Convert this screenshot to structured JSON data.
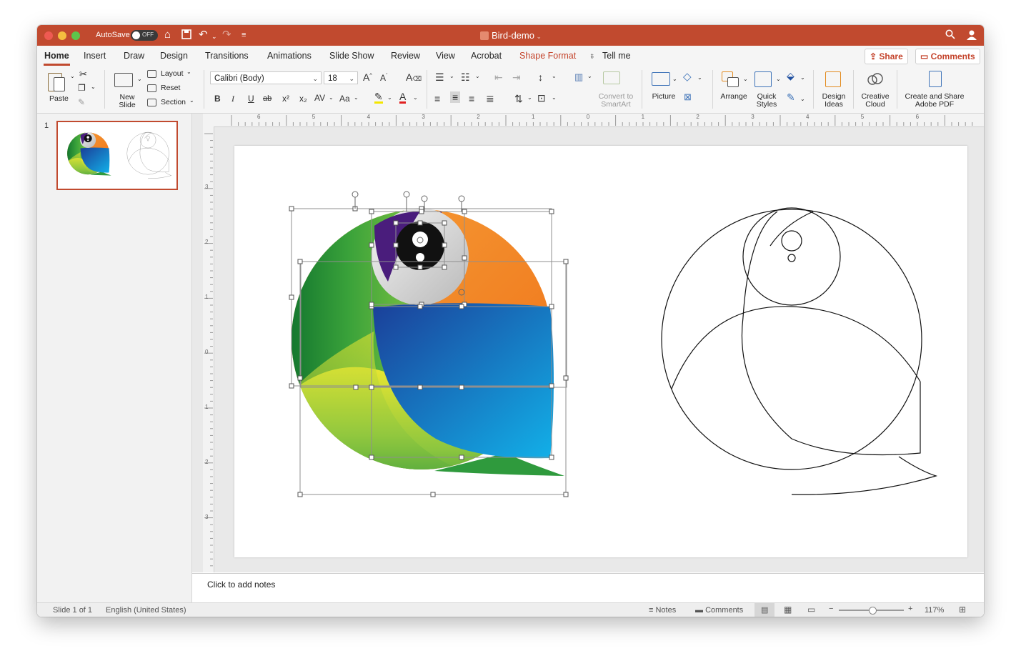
{
  "titlebar": {
    "autosave_label": "AutoSave",
    "autosave_state": "OFF",
    "doc_title": "Bird-demo"
  },
  "tabs": [
    {
      "label": "Home",
      "active": true
    },
    {
      "label": "Insert"
    },
    {
      "label": "Draw"
    },
    {
      "label": "Design"
    },
    {
      "label": "Transitions"
    },
    {
      "label": "Animations"
    },
    {
      "label": "Slide Show"
    },
    {
      "label": "Review"
    },
    {
      "label": "View"
    },
    {
      "label": "Acrobat"
    },
    {
      "label": "Shape Format",
      "highlight": true
    },
    {
      "label": "Tell me"
    }
  ],
  "share": {
    "share_label": "Share",
    "comments_label": "Comments"
  },
  "ribbon": {
    "paste": "Paste",
    "new_slide_line1": "New",
    "new_slide_line2": "Slide",
    "layout": "Layout",
    "reset": "Reset",
    "section": "Section",
    "font_name": "Calibri (Body)",
    "font_size": "18",
    "bold": "B",
    "italic": "I",
    "underline": "U",
    "strike": "ab",
    "superscript": "x²",
    "subscript": "x₂",
    "char_spacing": "AV",
    "change_case": "Aa",
    "convert_line1": "Convert to",
    "convert_line2": "SmartArt",
    "picture": "Picture",
    "arrange": "Arrange",
    "quick_styles_line1": "Quick",
    "quick_styles_line2": "Styles",
    "design_ideas_line1": "Design",
    "design_ideas_line2": "Ideas",
    "creative_cloud_line1": "Creative",
    "creative_cloud_line2": "Cloud",
    "create_share_line1": "Create and Share",
    "create_share_line2": "Adobe PDF"
  },
  "slides_pane": {
    "slide_number": "1"
  },
  "ruler": {
    "h_labels": [
      "6",
      "5",
      "4",
      "3",
      "2",
      "1",
      "0",
      "1",
      "2",
      "3",
      "4",
      "5",
      "6"
    ],
    "v_labels": [
      "3",
      "2",
      "1",
      "0",
      "1",
      "2",
      "3"
    ]
  },
  "notes": {
    "placeholder": "Click to add notes"
  },
  "status": {
    "slide_info": "Slide 1 of 1",
    "language": "English (United States)",
    "notes_label": "Notes",
    "comments_label": "Comments",
    "zoom": "117%"
  },
  "colors": {
    "accent": "#c14a2f",
    "bird_green_dark": "#0f7a34",
    "bird_green_light": "#e4e62d",
    "bird_orange": "#f07b1c",
    "bird_blue_dark": "#1c4aa0",
    "bird_blue_light": "#12aee6",
    "bird_purple": "#4a1d7c"
  }
}
